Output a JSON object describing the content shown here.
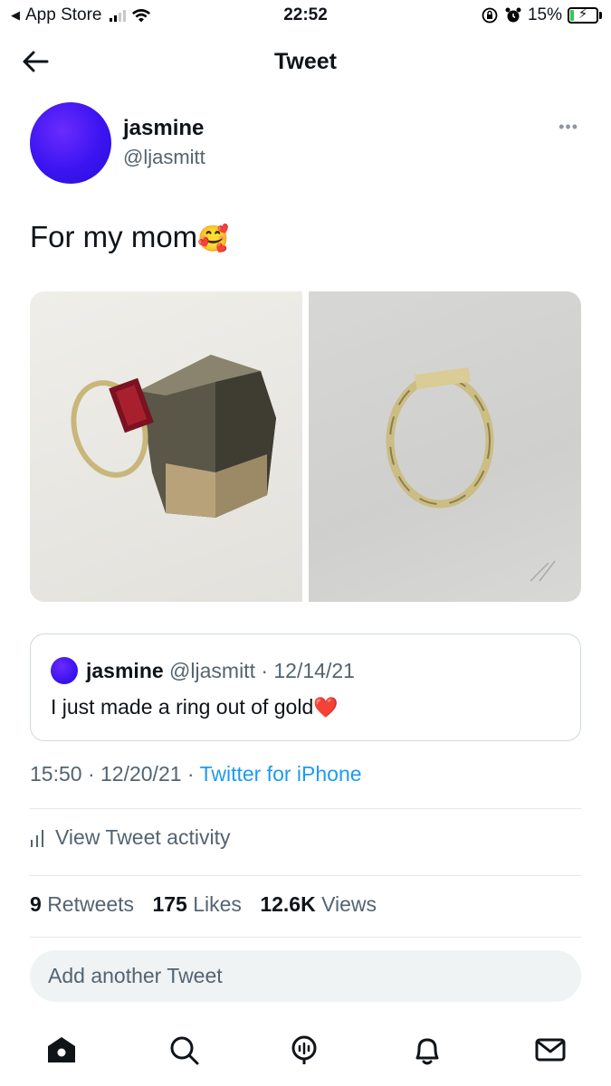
{
  "status_bar": {
    "back_app": "App Store",
    "time": "22:52",
    "battery": "15%",
    "battery_level": 0.15
  },
  "header": {
    "title": "Tweet"
  },
  "tweet": {
    "author_name": "jasmine",
    "author_handle": "@ljasmitt",
    "text": "For my mom",
    "emoji": "🥰",
    "more_icon": "more-dots-icon"
  },
  "quoted_tweet": {
    "author_name": "jasmine",
    "meta": "@ljasmitt · 12/14/21",
    "text": "I just made a ring out of gold",
    "emoji": "❤️"
  },
  "meta": {
    "time_date": "15:50 · 12/20/21 · ",
    "source": "Twitter for iPhone"
  },
  "activity": {
    "label": "View Tweet activity"
  },
  "stats": {
    "retweets_count": "9",
    "retweets_label": "Retweets",
    "likes_count": "175",
    "likes_label": "Likes",
    "views_count": "12.6K",
    "views_label": "Views"
  },
  "reply": {
    "placeholder": "Add another Tweet"
  },
  "tabbar": {
    "items": [
      "home-icon",
      "search-icon",
      "spaces-icon",
      "notifications-icon",
      "messages-icon"
    ]
  },
  "colors": {
    "accent": "#1d9bf0",
    "secondary_text": "#536471",
    "avatar": "#3b14f0"
  }
}
